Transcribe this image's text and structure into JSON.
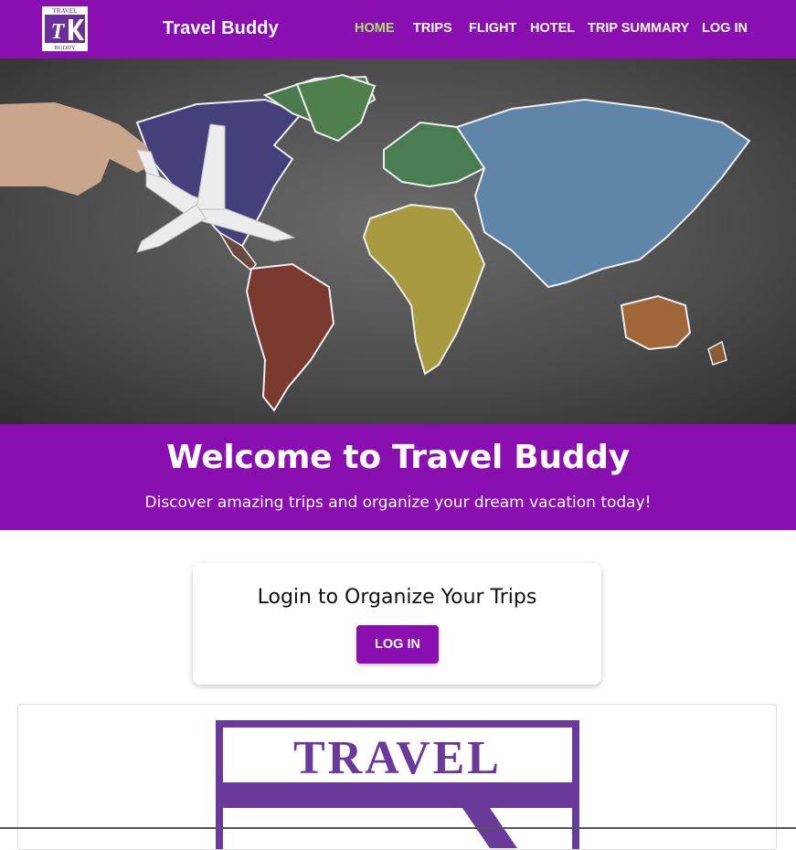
{
  "nav": {
    "logo": {
      "top_text": "TRAVEL",
      "mark": "TK",
      "bottom_text": "BUDDY",
      "icon": "travel-buddy-logo-icon"
    },
    "brand": "Travel Buddy",
    "links": [
      "HOME",
      "TRIPS",
      "FLIGHT",
      "HOTEL",
      "TRIP SUMMARY",
      "LOG IN"
    ],
    "active": "HOME",
    "colors": {
      "bar": "#8a0fb0",
      "active_link": "#a8e36a",
      "link": "#ffffff"
    }
  },
  "hero": {
    "image": "world-map-chalkboard-with-airplane"
  },
  "welcome": {
    "title": "Welcome to Travel Buddy",
    "subtitle": "Discover amazing trips and organize your dream vacation today!"
  },
  "login_card": {
    "title": "Login to Organize Your Trips",
    "button": "LOG IN"
  },
  "logo_panel": {
    "logo_text": "TRAVEL",
    "icon": "travel-buddy-large-logo"
  }
}
